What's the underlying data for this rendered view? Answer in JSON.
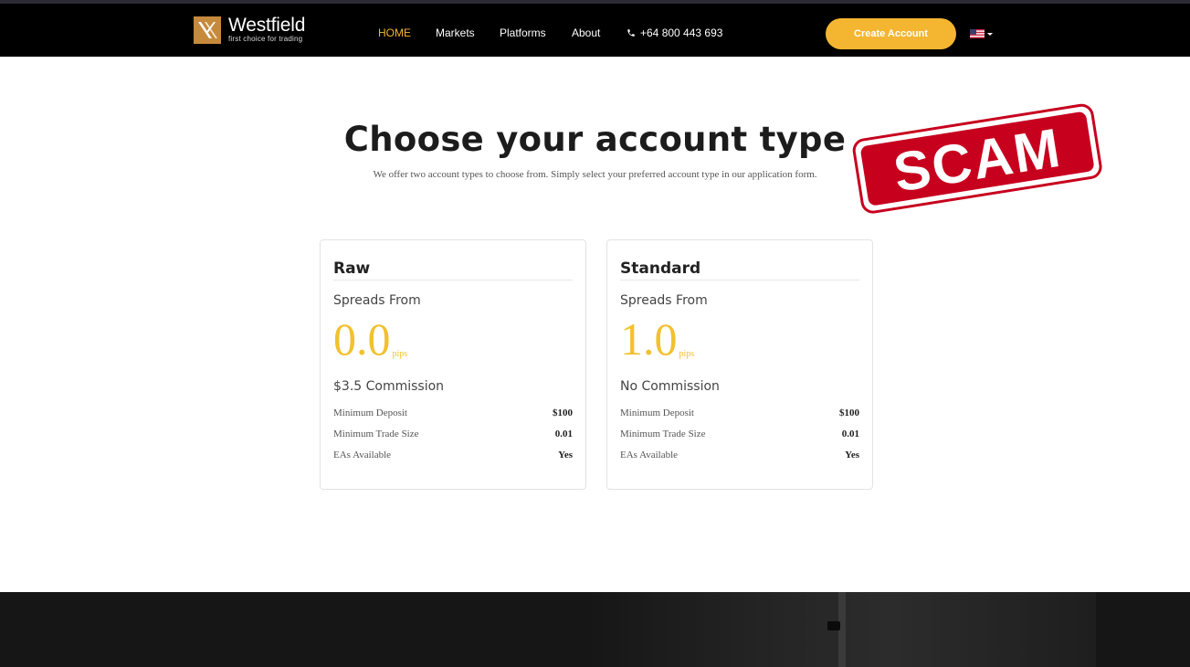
{
  "header": {
    "brand": {
      "name": "Westfield",
      "tagline": "first choice for trading"
    },
    "nav": [
      {
        "label": "HOME",
        "active": true
      },
      {
        "label": "Markets",
        "active": false
      },
      {
        "label": "Platforms",
        "active": false
      },
      {
        "label": "About",
        "active": false
      }
    ],
    "phone": {
      "icon": "phone-icon",
      "number": "+64 800 443 693"
    },
    "cta_label": "Create Account",
    "language": {
      "icon": "us-flag-icon"
    }
  },
  "main": {
    "title": "Choose your account type",
    "subtitle": "We offer two account types to choose from. Simply select your preferred account type in our application form.",
    "stamp": "SCAM"
  },
  "accounts": [
    {
      "name": "Raw",
      "spreads_label": "Spreads From",
      "spread_value": "0.0",
      "spread_unit": "pips",
      "commission": "$3.5 Commission",
      "details": [
        {
          "label": "Minimum Deposit",
          "value": "$100"
        },
        {
          "label": "Minimum Trade Size",
          "value": "0.01"
        },
        {
          "label": "EAs Available",
          "value": "Yes"
        }
      ]
    },
    {
      "name": "Standard",
      "spreads_label": "Spreads From",
      "spread_value": "1.0",
      "spread_unit": "pips",
      "commission": "No Commission",
      "details": [
        {
          "label": "Minimum Deposit",
          "value": "$100"
        },
        {
          "label": "Minimum Trade Size",
          "value": "0.01"
        },
        {
          "label": "EAs Available",
          "value": "Yes"
        }
      ]
    }
  ],
  "colors": {
    "accent": "#f4b630",
    "spread": "#f2c12e",
    "stamp": "#c7001e",
    "header_bg": "#000000"
  }
}
